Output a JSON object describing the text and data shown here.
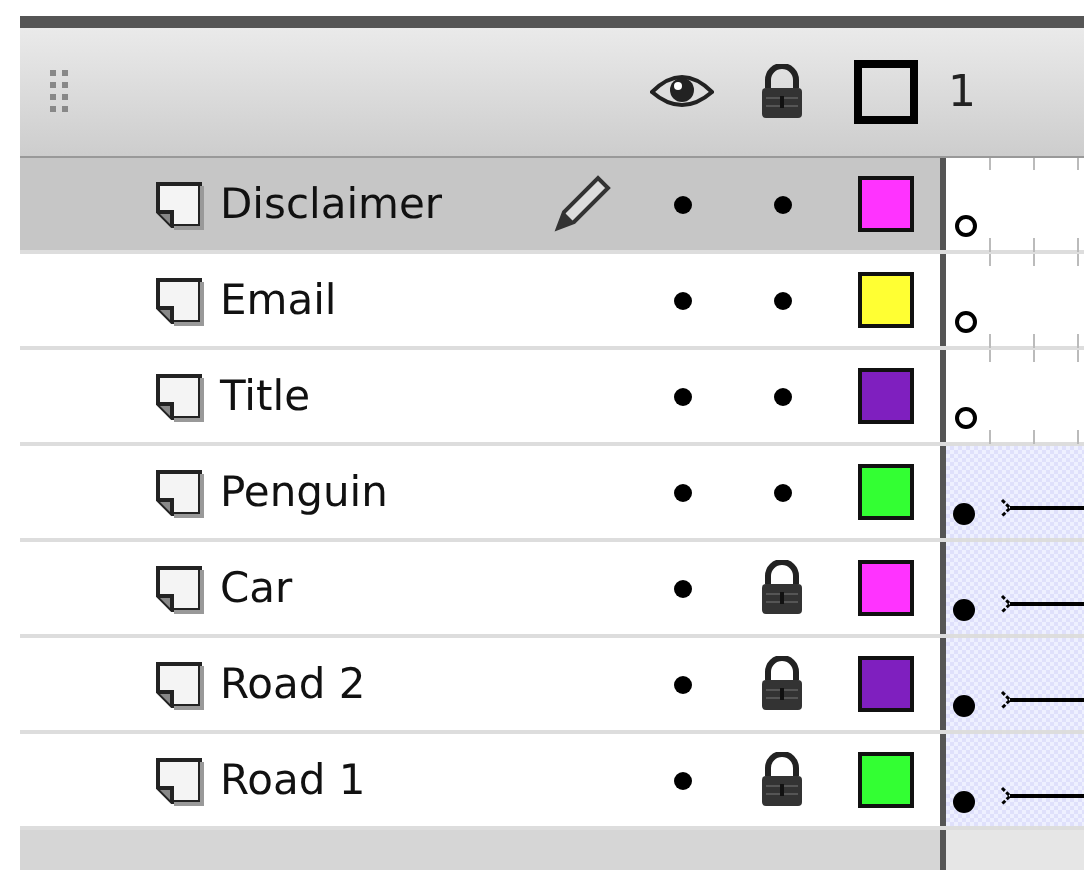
{
  "header": {
    "frame_number": "1"
  },
  "layers": [
    {
      "name": "Disclaimer",
      "selected": true,
      "visible": true,
      "locked": false,
      "color": "#ff33ff",
      "kind": "empty"
    },
    {
      "name": "Email",
      "selected": false,
      "visible": true,
      "locked": false,
      "color": "#ffff33",
      "kind": "empty"
    },
    {
      "name": "Title",
      "selected": false,
      "visible": true,
      "locked": false,
      "color": "#7f1fbf",
      "kind": "empty"
    },
    {
      "name": "Penguin",
      "selected": false,
      "visible": true,
      "locked": false,
      "color": "#33ff33",
      "kind": "tween"
    },
    {
      "name": "Car",
      "selected": false,
      "visible": true,
      "locked": true,
      "color": "#ff33ff",
      "kind": "tween"
    },
    {
      "name": "Road 2",
      "selected": false,
      "visible": true,
      "locked": true,
      "color": "#7f1fbf",
      "kind": "tween"
    },
    {
      "name": "Road 1",
      "selected": false,
      "visible": true,
      "locked": true,
      "color": "#33ff33",
      "kind": "tween"
    }
  ]
}
